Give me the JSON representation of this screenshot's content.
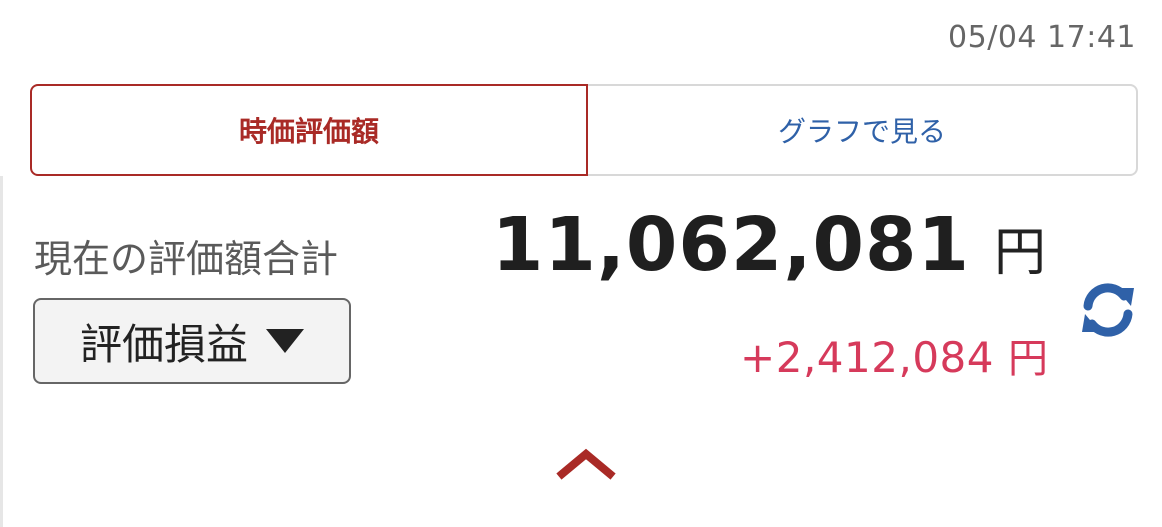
{
  "header": {
    "timestamp": "05/04 17:41"
  },
  "tabs": [
    {
      "label": "時価評価額",
      "active": true
    },
    {
      "label": "グラフで見る",
      "active": false
    }
  ],
  "summary": {
    "total_label": "現在の評価額合計",
    "total_value": "11,062,081",
    "currency": "円",
    "dropdown_selected": "評価損益",
    "gain_value": "+2,412,084",
    "gain_unit": "円"
  },
  "icons": {
    "refresh": "refresh-icon",
    "collapse": "chevron-up-icon",
    "dropdown": "triangle-down-icon"
  },
  "colors": {
    "accent": "#a92a26",
    "link": "#2f61a8",
    "gain": "#d63a5b",
    "refresh": "#2f61a8"
  }
}
